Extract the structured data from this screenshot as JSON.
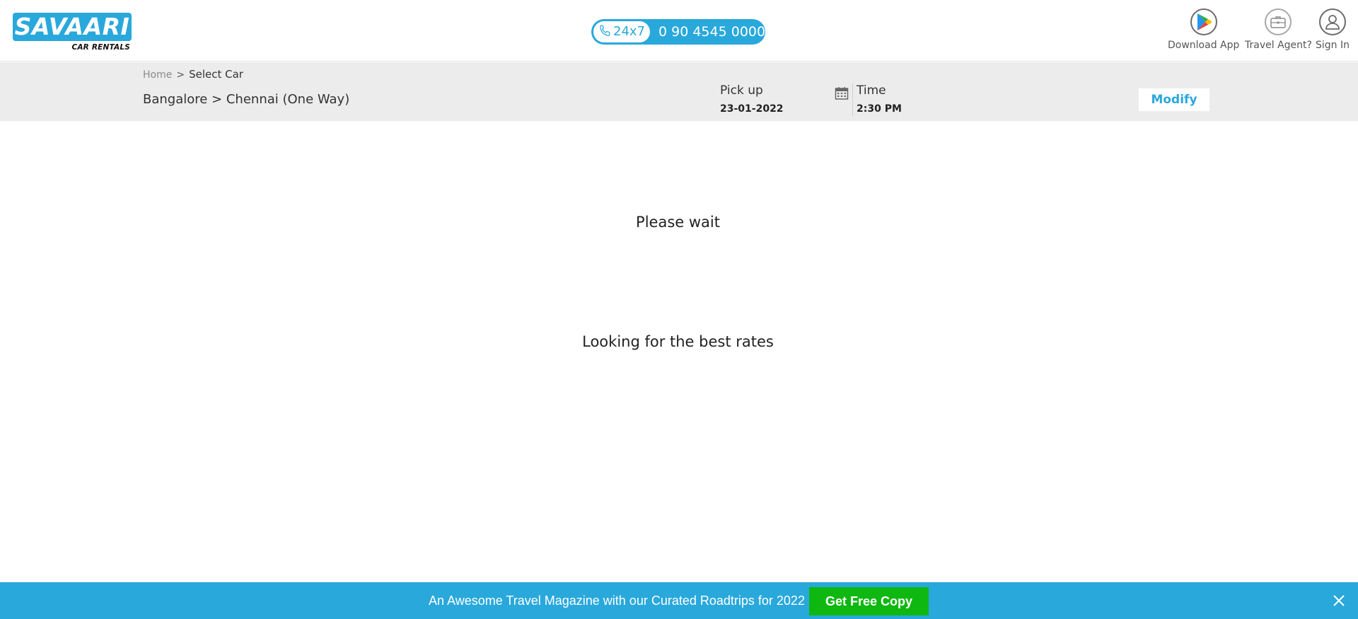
{
  "header": {
    "logo": {
      "title": "SAVAARI",
      "subtitle": "CAR RENTALS",
      "color": "#29a8dc"
    },
    "support": {
      "badge": "24x7",
      "phone": "0 90 4545 0000",
      "icon": "phone-icon"
    },
    "links": [
      {
        "label": "Download App",
        "icon": "play-store-icon"
      },
      {
        "label": "Travel Agent?",
        "icon": "briefcase-icon"
      },
      {
        "label": "Sign In",
        "icon": "user-icon"
      }
    ]
  },
  "search": {
    "breadcrumb": {
      "home": "Home",
      "separator": ">",
      "current": "Select Car"
    },
    "route": "Bangalore > Chennai (One Way)",
    "pickup": {
      "label": "Pick up",
      "date": "23-01-2022"
    },
    "time": {
      "label": "Time",
      "value": "2:30 PM"
    },
    "modify_label": "Modify"
  },
  "main": {
    "wait_title": "Please wait",
    "loading_message": "Looking for the best rates"
  },
  "banner": {
    "text": "An Awesome Travel Magazine with our Curated Roadtrips for 2022",
    "button_label": "Get Free Copy",
    "background": "#29a8dc",
    "button_color": "#0eb810"
  }
}
